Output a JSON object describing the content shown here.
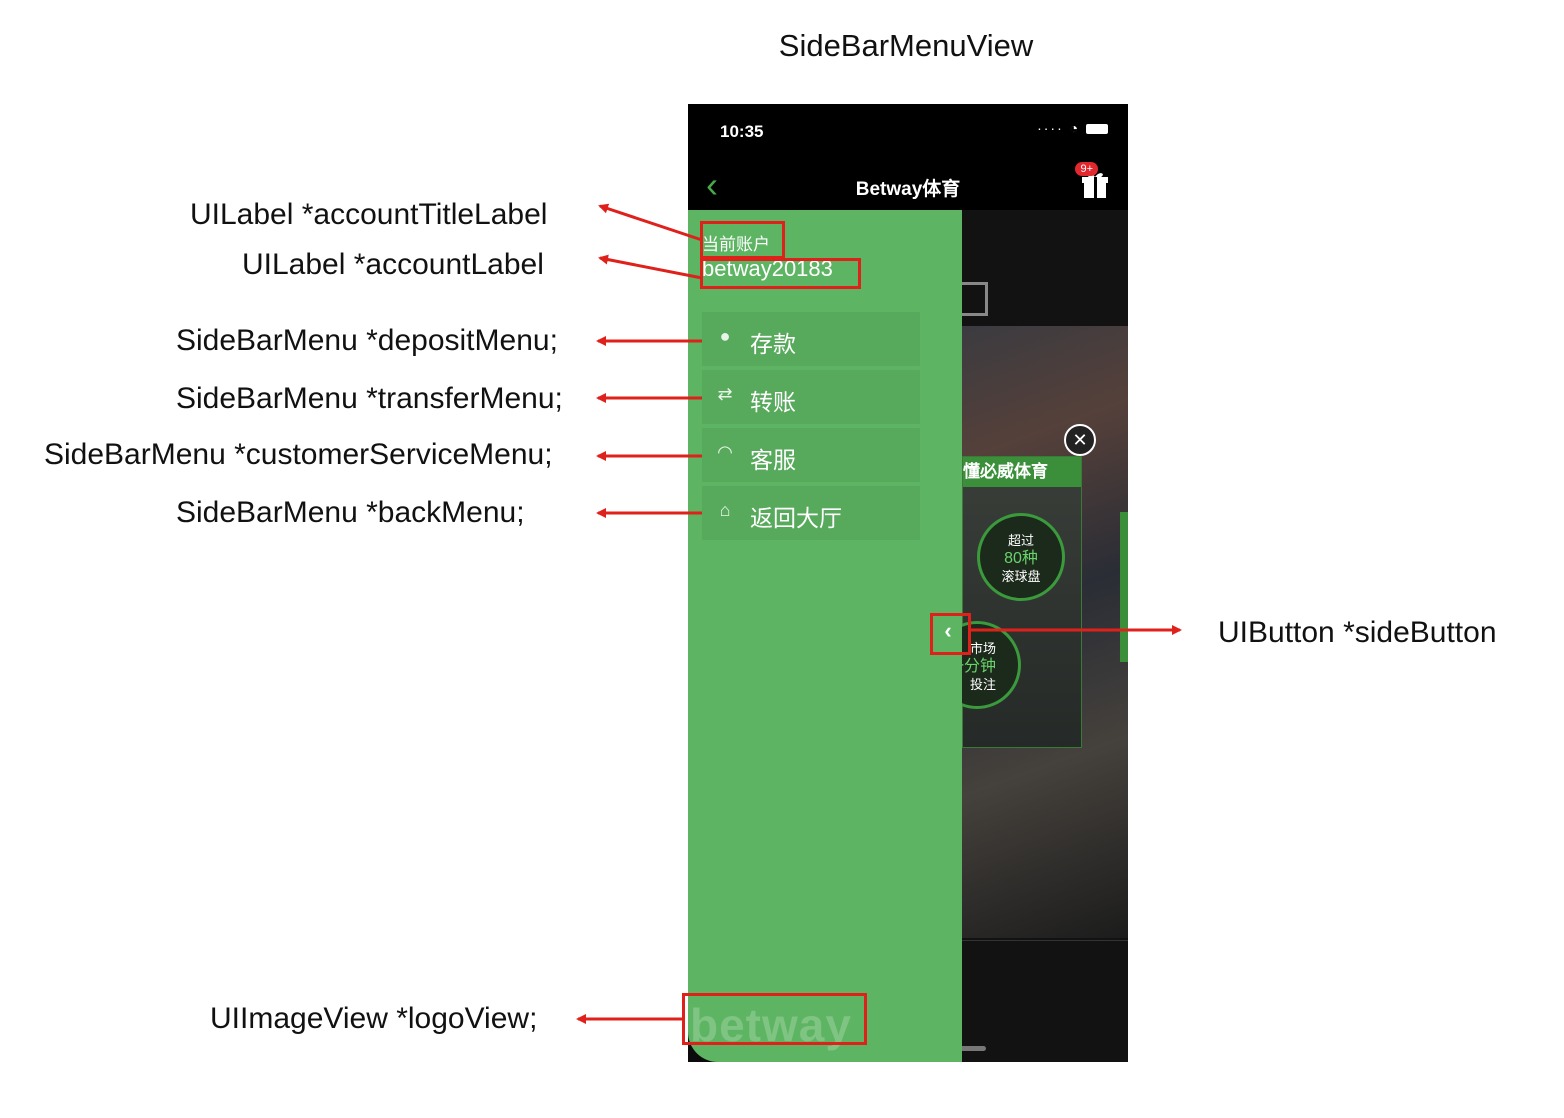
{
  "diagram_title": "SideBarMenuView",
  "annotations": {
    "account_title_label": "UILabel  *accountTitleLabel",
    "account_label": "UILabel  *accountLabel",
    "deposit_menu": "SideBarMenu *depositMenu;",
    "transfer_menu": "SideBarMenu *transferMenu;",
    "customer_service_menu": "SideBarMenu *customerServiceMenu;",
    "back_menu": "SideBarMenu *backMenu;",
    "side_button": "UIButton *sideButton",
    "logo_view": "UIImageView *logoView;"
  },
  "phone": {
    "status_time": "10:35",
    "nav_title": "Betway体育",
    "badge": "9+"
  },
  "sidebar": {
    "account_title": "当前账户",
    "account": "betway20183",
    "menu": [
      {
        "icon": "piggy-bank-icon",
        "label": "存款"
      },
      {
        "icon": "transfer-icon",
        "label": "转账"
      },
      {
        "icon": "headset-icon",
        "label": "客服"
      },
      {
        "icon": "home-icon",
        "label": "返回大厅"
      }
    ],
    "logo": "betway"
  },
  "promo": {
    "header": "懂必威体育",
    "circle1": [
      "超过",
      "80种",
      "滚球盘"
    ],
    "circle2": [
      "市场",
      "一分钟",
      "投注"
    ]
  },
  "colors": {
    "sidebar_green": "#5db462",
    "annotation_red": "#e0201b"
  }
}
